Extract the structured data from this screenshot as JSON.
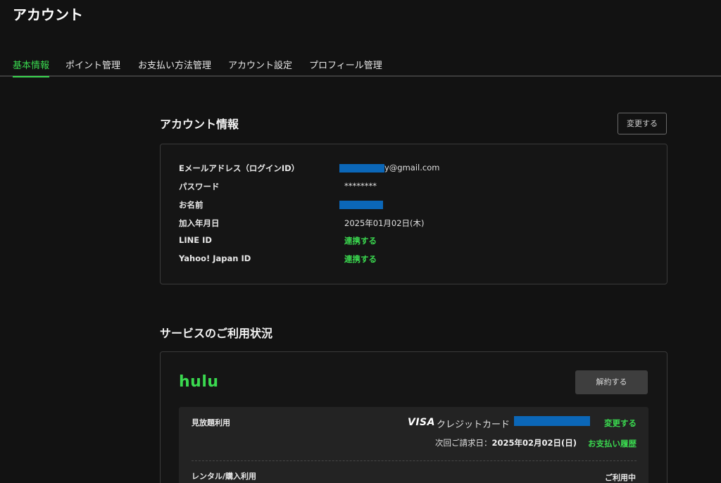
{
  "page": {
    "title": "アカウント"
  },
  "tabs": [
    {
      "label": "基本情報",
      "active": true
    },
    {
      "label": "ポイント管理",
      "active": false
    },
    {
      "label": "お支払い方法管理",
      "active": false
    },
    {
      "label": "アカウント設定",
      "active": false
    },
    {
      "label": "プロフィール管理",
      "active": false
    }
  ],
  "account_info": {
    "title": "アカウント情報",
    "change_button": "変更する",
    "rows": [
      {
        "label": "Eメールアドレス（ログインID）",
        "value": "y@gmail.com",
        "redacted": true
      },
      {
        "label": "パスワード",
        "value": "********"
      },
      {
        "label": "お名前",
        "value": "",
        "redacted": true
      },
      {
        "label": "加入年月日",
        "value": "2025年01月02日(木)"
      },
      {
        "label": "LINE ID",
        "value": "連携する",
        "link": true
      },
      {
        "label": "Yahoo! Japan ID",
        "value": "連携する",
        "link": true
      }
    ]
  },
  "service": {
    "title": "サービスのご利用状況",
    "logo_text": "hulu",
    "cancel_button": "解約する",
    "plan": {
      "label": "見放題利用",
      "card_brand": "VISA",
      "card_type": "クレジットカード",
      "change_link": "変更する",
      "billing_label": "次回ご請求日：",
      "billing_date": "2025年02月02日(日)",
      "history_link": "お支払い履歴"
    },
    "rental": {
      "label": "レンタル/購入利用",
      "status": "ご利用中"
    }
  },
  "colors": {
    "accent": "#3ad84f",
    "background": "#121212",
    "redaction": "#0b67b8"
  }
}
